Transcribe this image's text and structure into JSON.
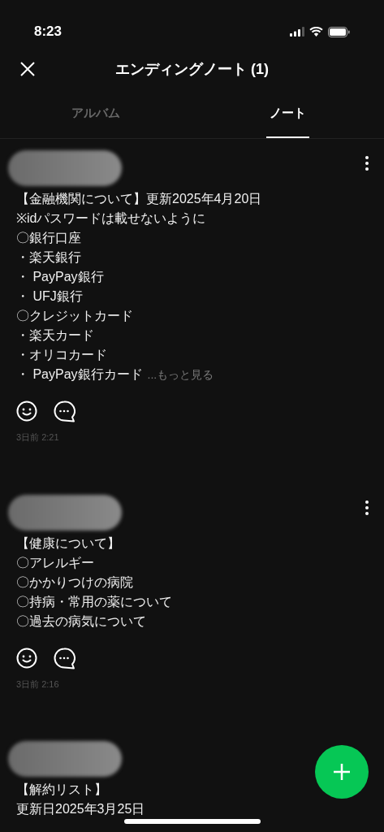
{
  "status_bar": {
    "time": "8:23"
  },
  "header": {
    "title": "エンディングノート (1)"
  },
  "tabs": [
    {
      "label": "アルバム",
      "selected": false
    },
    {
      "label": "ノート",
      "selected": true
    }
  ],
  "notes": [
    {
      "lines": [
        "【金融機関について】更新2025年4月20日",
        "※idパスワードは載せないように",
        "〇銀行口座",
        "・楽天銀行",
        "・ PayPay銀行",
        "・ UFJ銀行",
        "〇クレジットカード",
        "・楽天カード",
        "・オリコカード",
        "・ PayPay銀行カード"
      ],
      "more": "...もっと見る",
      "time": "3日前 2:21"
    },
    {
      "lines": [
        "【健康について】",
        "〇アレルギー",
        "〇かかりつけの病院",
        "〇持病・常用の薬について",
        "〇過去の病気について"
      ],
      "time": "3日前 2:16"
    },
    {
      "lines": [
        "【解約リスト】",
        "更新日2025年3月25日"
      ]
    }
  ]
}
